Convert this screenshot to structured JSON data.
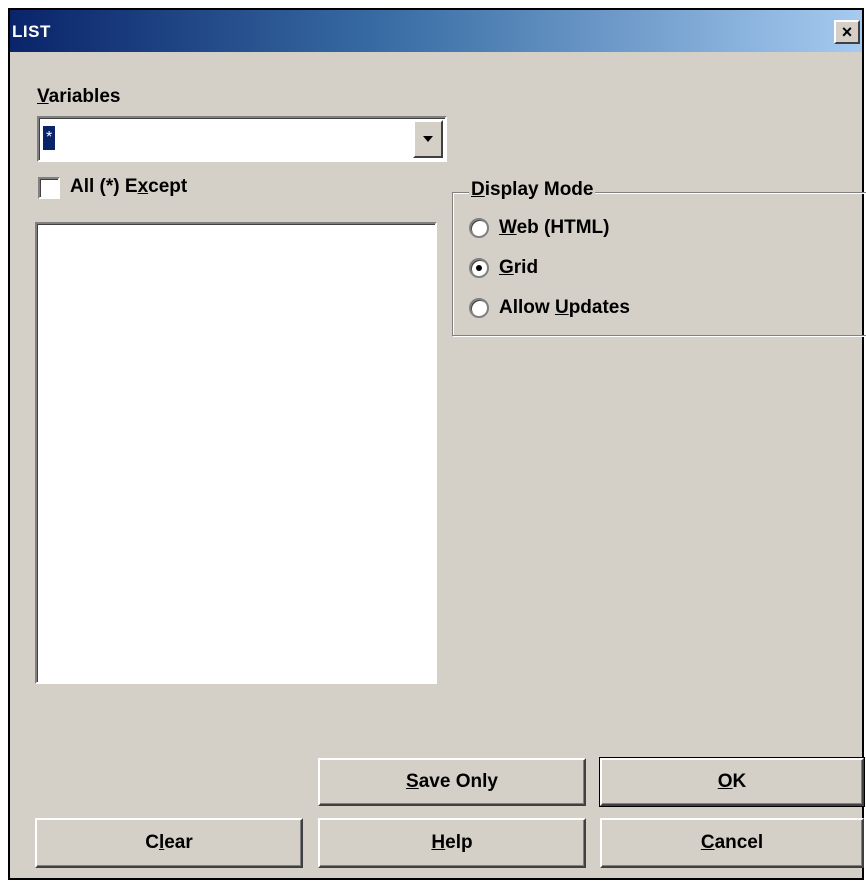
{
  "window": {
    "title": "LIST",
    "close_glyph": "×"
  },
  "variables": {
    "label_accel": "V",
    "label_rest": "ariables",
    "selected_value": "*"
  },
  "except_checkbox": {
    "label_pre": "All (*) E",
    "label_accel": "x",
    "label_post": "cept",
    "checked": false
  },
  "display_mode": {
    "legend_accel": "D",
    "legend_rest": "isplay Mode",
    "options": [
      {
        "accel": "W",
        "rest": "eb (HTML)",
        "selected": false
      },
      {
        "accel": "G",
        "rest": "rid",
        "selected": true
      },
      {
        "pre": "Allow ",
        "accel": "U",
        "rest": "pdates",
        "selected": false
      }
    ]
  },
  "buttons": {
    "save_accel": "S",
    "save_rest": "ave Only",
    "ok_accel": "O",
    "ok_rest": "K",
    "clear_pre": "C",
    "clear_accel": "l",
    "clear_rest": "ear",
    "help_accel": "H",
    "help_rest": "elp",
    "cancel_accel": "C",
    "cancel_rest": "ancel"
  },
  "icons": {
    "close": "close-icon",
    "dropdown": "triangle-down-icon"
  }
}
